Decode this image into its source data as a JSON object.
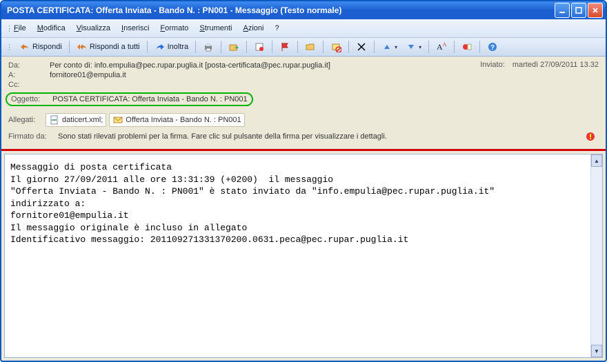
{
  "window": {
    "title": "POSTA CERTIFICATA: Offerta Inviata - Bando N. : PN001 - Messaggio (Testo normale)"
  },
  "menu": {
    "file": "File",
    "modifica": "Modifica",
    "visualizza": "Visualizza",
    "inserisci": "Inserisci",
    "formato": "Formato",
    "strumenti": "Strumenti",
    "azioni": "Azioni",
    "help": "?"
  },
  "toolbar": {
    "rispondi": "Rispondi",
    "rispondi_tutti": "Rispondi a tutti",
    "inoltra": "Inoltra"
  },
  "headers": {
    "da_label": "Da:",
    "da_value": "Per conto di: info.empulia@pec.rupar.puglia.it [posta-certificata@pec.rupar.puglia.it]",
    "inviato_label": "Inviato:",
    "inviato_value": "martedì 27/09/2011 13.32",
    "a_label": "A:",
    "a_value": "fornitore01@empulia.it",
    "cc_label": "Cc:",
    "cc_value": "",
    "oggetto_label": "Oggetto:",
    "oggetto_value": "POSTA CERTIFICATA: Offerta Inviata - Bando N. : PN001",
    "allegati_label": "Allegati:",
    "attach1": "daticert.xml;",
    "attach2": "Offerta Inviata - Bando N. : PN001",
    "firmato_label": "Firmato da:",
    "firmato_value": "Sono stati rilevati problemi per la firma. Fare clic sul pulsante della firma per visualizzare i dettagli."
  },
  "body": {
    "line1": "Messaggio di posta certificata",
    "line2": "Il giorno 27/09/2011 alle ore 13:31:39 (+0200)  il messaggio",
    "line3": "\"Offerta Inviata - Bando N. : PN001\" è stato inviato da \"info.empulia@pec.rupar.puglia.it\"",
    "line4": "indirizzato a:",
    "line5": "fornitore01@empulia.it",
    "line6": "Il messaggio originale è incluso in allegato",
    "line7": "Identificativo messaggio: 201109271331370200.0631.peca@pec.rupar.puglia.it"
  }
}
